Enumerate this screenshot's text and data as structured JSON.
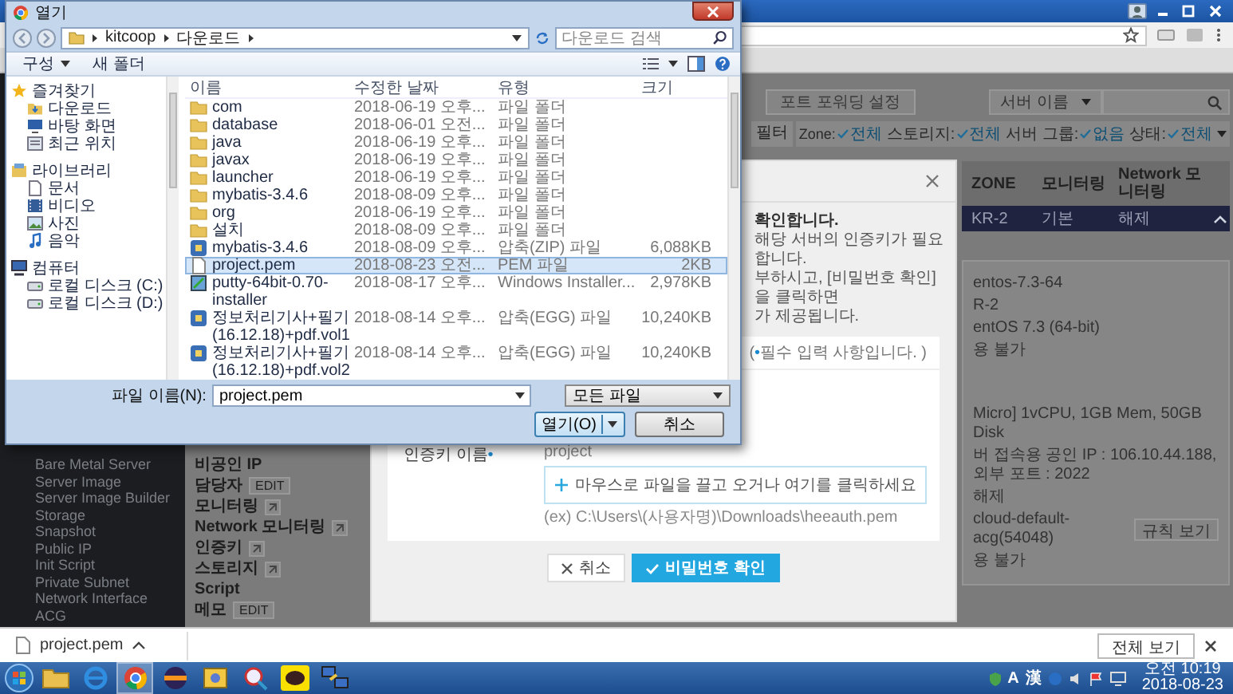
{
  "file_dialog": {
    "title": "열기",
    "path": [
      "kitcoop",
      "다운로드"
    ],
    "search_placeholder": "다운로드 검색",
    "toolbar": [
      "구성",
      "새 폴더"
    ],
    "nav": [
      {
        "label": "즐겨찾기",
        "kind": "favorites",
        "children": [
          {
            "label": "다운로드",
            "kind": "downloads"
          },
          {
            "label": "바탕 화면",
            "kind": "desktop"
          },
          {
            "label": "최근 위치",
            "kind": "recent"
          }
        ]
      },
      {
        "label": "라이브러리",
        "kind": "library",
        "children": [
          {
            "label": "문서",
            "kind": "documents"
          },
          {
            "label": "비디오",
            "kind": "videos"
          },
          {
            "label": "사진",
            "kind": "pictures"
          },
          {
            "label": "음악",
            "kind": "music"
          }
        ]
      },
      {
        "label": "컴퓨터",
        "kind": "computer",
        "children": [
          {
            "label": "로컬 디스크 (C:)",
            "kind": "drive"
          },
          {
            "label": "로컬 디스크 (D:)",
            "kind": "drive"
          }
        ]
      }
    ],
    "columns": [
      "이름",
      "수정한 날짜",
      "유형",
      "크기"
    ],
    "files": [
      {
        "name": "com",
        "modified": "2018-06-19 오후...",
        "type": "파일 폴더",
        "kind": "folder",
        "selected": false
      },
      {
        "name": "database",
        "modified": "2018-06-01 오전...",
        "type": "파일 폴더",
        "kind": "folder",
        "selected": false
      },
      {
        "name": "java",
        "modified": "2018-06-19 오후...",
        "type": "파일 폴더",
        "kind": "folder",
        "selected": false
      },
      {
        "name": "javax",
        "modified": "2018-06-19 오후...",
        "type": "파일 폴더",
        "kind": "folder",
        "selected": false
      },
      {
        "name": "launcher",
        "modified": "2018-06-19 오후...",
        "type": "파일 폴더",
        "kind": "folder",
        "selected": false
      },
      {
        "name": "mybatis-3.4.6",
        "modified": "2018-08-09 오후...",
        "type": "파일 폴더",
        "kind": "folder",
        "selected": false
      },
      {
        "name": "org",
        "modified": "2018-06-19 오후...",
        "type": "파일 폴더",
        "kind": "folder",
        "selected": false
      },
      {
        "name": "설치",
        "modified": "2018-08-09 오후...",
        "type": "파일 폴더",
        "kind": "folder",
        "selected": false
      },
      {
        "name": "mybatis-3.4.6",
        "modified": "2018-08-09 오후...",
        "type": "압축(ZIP) 파일",
        "size": "6,088KB",
        "kind": "archive",
        "selected": false
      },
      {
        "name": "project.pem",
        "modified": "2018-08-23 오전...",
        "type": "PEM 파일",
        "size": "2KB",
        "kind": "document",
        "selected": true
      },
      {
        "name": "putty-64bit-0.70-installer",
        "modified": "2018-08-17 오후...",
        "type": "Windows Installer...",
        "size": "2,978KB",
        "kind": "installer",
        "selected": false
      },
      {
        "name": "정보처리기사+필기(16.12.18)+pdf.vol1",
        "modified": "2018-08-14 오후...",
        "type": "압축(EGG) 파일",
        "size": "10,240KB",
        "kind": "archive",
        "selected": false
      },
      {
        "name": "정보처리기사+필기(16.12.18)+pdf.vol2",
        "modified": "2018-08-14 오후...",
        "type": "압축(EGG) 파일",
        "size": "10,240KB",
        "kind": "archive",
        "selected": false
      }
    ],
    "filename_label": "파일 이름(N):",
    "filename": "project.pem",
    "filter": "모든 파일",
    "buttons": [
      {
        "label": "열기(O)",
        "kind": "split"
      },
      {
        "label": "취소",
        "kind": "plain"
      }
    ]
  },
  "page": {
    "sidebar": [
      "Bare Metal Server",
      "Server Image",
      "Server Image Builder",
      "Storage",
      "Snapshot",
      "Public IP",
      "Init Script",
      "Private Subnet",
      "Network Interface",
      "ACG"
    ],
    "port_forwarding": "포트 포워딩 설정",
    "search_scope": "서버 이름",
    "filter": {
      "label": "필터",
      "groups": [
        {
          "name": "Zone:",
          "value": "전체"
        },
        {
          "name": "스토리지:",
          "value": "전체"
        },
        {
          "name": "서버 그룹:",
          "value": "없음"
        },
        {
          "name": "상태:",
          "value": "전체"
        }
      ]
    },
    "details": [
      {
        "label": "비공인 IP",
        "kind": "text"
      },
      {
        "label": "담당자",
        "kind": "edit",
        "action": "EDIT"
      },
      {
        "label": "모니터링",
        "kind": "link"
      },
      {
        "label": "Network 모니터링",
        "kind": "link"
      },
      {
        "label": "인증키",
        "kind": "link"
      },
      {
        "label": "스토리지",
        "kind": "link"
      },
      {
        "label": "Script",
        "kind": "text"
      },
      {
        "label": "메모",
        "kind": "edit",
        "action": "EDIT"
      }
    ],
    "server_table": {
      "columns": [
        "ZONE",
        "모니터링",
        "Network 모니터링"
      ],
      "rows": [
        {
          "cells": [
            "KR-2",
            "기본",
            "해제"
          ],
          "selected": true,
          "expanded": true
        }
      ]
    },
    "server_details": [
      [
        {
          "value": "entos-7.3-64"
        },
        {
          "value": "R-2"
        },
        {
          "value": "entOS 7.3 (64-bit)"
        },
        {
          "value": "용 불가"
        }
      ],
      [
        {
          "value": "Micro] 1vCPU, 1GB Mem, 50GB Disk"
        },
        {
          "value": "버 접속용 공인 IP : 106.10.44.188, 외부 포트 : 2022"
        },
        {
          "value": "해제"
        },
        {
          "value": "cloud-default-acg(54048)",
          "button": "규칙 보기"
        },
        {
          "value": "용 불가"
        }
      ]
    ]
  },
  "modal": {
    "intro": [
      {
        "text": "확인합니다.",
        "kind": "heading"
      },
      {
        "text": "해당 서버의 인증키가 필요합니다.",
        "kind": "body"
      },
      {
        "text": "부하시고, [비밀번호 확인]을 클릭하면",
        "kind": "body"
      },
      {
        "text": "가 제공됩니다.",
        "kind": "body"
      }
    ],
    "required_note": {
      "before": "(",
      "mark": "•",
      "after": "필수 입력 사항입니다. )"
    },
    "field": {
      "label": "인증키 이름",
      "mark": "•",
      "value": "project",
      "dropzone": "마우스로 파일을 끌고 오거나 여기를 클릭하세요",
      "example": "(ex) C:\\Users\\(사용자명)\\Downloads\\heeauth.pem"
    },
    "buttons": [
      {
        "label": "취소",
        "kind": "cancel"
      },
      {
        "label": "비밀번호 확인",
        "kind": "primary"
      }
    ]
  },
  "download_bar": {
    "file": "project.pem",
    "show_all": "전체 보기"
  },
  "taskbar": {
    "ime": [
      "A",
      "漢"
    ],
    "time": "오전 10:19",
    "date": "2018-08-23"
  }
}
